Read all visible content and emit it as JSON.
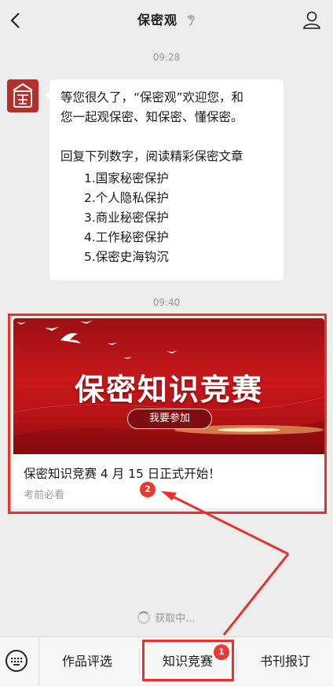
{
  "header": {
    "title": "保密观"
  },
  "messages": [
    {
      "time": "09:28",
      "line1": "等您很久了，“保密观”欢迎您，和",
      "line2": "您一起观保密、知保密、懂保密。",
      "line3": "回复下列数字，阅读精彩保密文章",
      "items": [
        "1.国家秘密保护",
        "2.个人隐私保护",
        "3.商业秘密保护",
        "4.工作秘密保护",
        "5.保密史海钩沉"
      ]
    }
  ],
  "card": {
    "time": "09:40",
    "banner_title": "保密知识竞赛",
    "button_label": "我要参加",
    "title": "保密知识竞赛 4 月 15 日正式开始！",
    "subtitle": "考前必看"
  },
  "loading_text": "获取中...",
  "bottom_tabs": [
    "作品评选",
    "知识竞赛",
    "书刊报订"
  ],
  "annotations": {
    "badge1": "1",
    "badge2": "2"
  },
  "colors": {
    "annotation_red": "#e8312a",
    "banner_red": "#c7181b",
    "background": "#ededed"
  },
  "icons": {
    "back": "back-icon",
    "profile": "user-icon",
    "voice": "ear-icon",
    "keyboard": "keyboard-icon"
  }
}
